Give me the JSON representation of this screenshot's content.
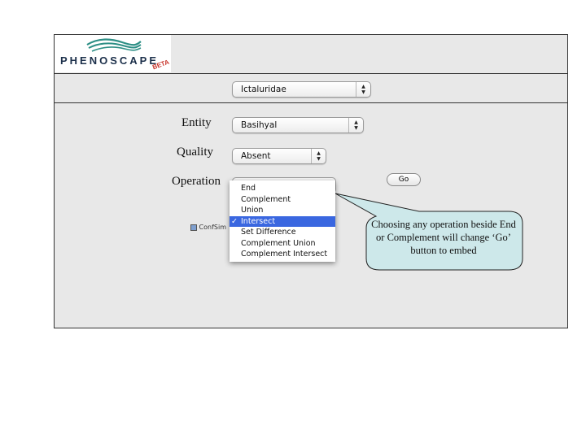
{
  "logo": {
    "name": "PHENOSCAPE",
    "badge": "BETA"
  },
  "taxon": {
    "value": "Ictaluridae"
  },
  "form": {
    "entity_label": "Entity",
    "entity_value": "Basihyal",
    "quality_label": "Quality",
    "quality_value": "Absent",
    "operation_label": "Operation",
    "go_label": "Go"
  },
  "operation_menu": {
    "options": [
      "End",
      "Complement",
      "Union",
      "Intersect",
      "Set Difference",
      "Complement Union",
      "Complement Intersect"
    ],
    "selected": "Intersect",
    "check_glyph": "✓"
  },
  "hidden_item": {
    "label": "ConfSim"
  },
  "callout": {
    "text": "Choosing any operation beside End or Complement will change ‘Go’ button to embed",
    "fill": "#cde8ea"
  },
  "colors": {
    "menu_highlight": "#3a67e0",
    "logo_text": "#1b2f4a",
    "logo_waves": "#2e8f86",
    "beta": "#c8332a"
  },
  "icons": {
    "popup_arrows": "up-down-arrows-icon",
    "logo_mark": "waves-icon",
    "check": "checkmark-icon"
  }
}
